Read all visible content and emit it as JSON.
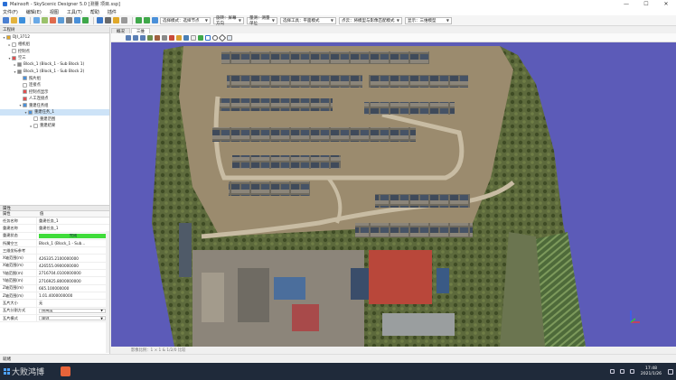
{
  "titlebar": {
    "title": "Mainsoft - SkyScenic Designer 5.0 [测量 项目.ssp]",
    "btns": [
      "—",
      "☐",
      "✕"
    ]
  },
  "menu": [
    "文件(F)",
    "编辑(E)",
    "视图",
    "工具(T)",
    "帮助",
    "插件"
  ],
  "toolbar": {
    "combos": [
      {
        "label": "选择模式：选择节点",
        "w": 56
      },
      {
        "label": "旋转：屏幕方向",
        "w": 34
      },
      {
        "label": "量测：测量单位",
        "w": 34
      },
      {
        "label": "选择工具：平面模式",
        "w": 62
      },
      {
        "label": "点云：将模型与影像匹配模式",
        "w": 70
      },
      {
        "label": "显示：三维模型",
        "w": 52
      }
    ]
  },
  "left_panel": {
    "title": "工程树",
    "tree": [
      {
        "indent": 0,
        "exp": "▾",
        "icon": "#e0a828",
        "label": "DJI_3712"
      },
      {
        "indent": 1,
        "exp": "▸",
        "icon": "#ffffff",
        "label": "相机组"
      },
      {
        "indent": 1,
        "exp": "",
        "icon": "#ffffff",
        "label": "控制点"
      },
      {
        "indent": 1,
        "exp": "▾",
        "icon": "#e05050",
        "label": "空三"
      },
      {
        "indent": 2,
        "exp": "▸",
        "icon": "#888888",
        "label": "Block_1 (Block_1 - Sub Block 1)"
      },
      {
        "indent": 2,
        "exp": "▾",
        "icon": "#888888",
        "label": "Block_1 (Block_1 - Sub Block 2)"
      },
      {
        "indent": 3,
        "exp": "",
        "icon": "#4a90d9",
        "label": "照片组"
      },
      {
        "indent": 3,
        "exp": "",
        "icon": "#ffffff",
        "label": "连接点"
      },
      {
        "indent": 3,
        "exp": "",
        "icon": "#e05050",
        "label": "控制点显示"
      },
      {
        "indent": 3,
        "exp": "",
        "icon": "#e05050",
        "label": "人工连接点"
      },
      {
        "indent": 3,
        "exp": "▾",
        "icon": "#4a90d9",
        "label": "重建任务组"
      },
      {
        "indent": 4,
        "exp": "▾",
        "icon": "#4a90d9",
        "label": "重建任务_1",
        "selected": true
      },
      {
        "indent": 5,
        "exp": "",
        "icon": "#ffffff",
        "label": "重建范围"
      },
      {
        "indent": 5,
        "exp": "▸",
        "icon": "#ffffff",
        "label": "重建结果"
      }
    ]
  },
  "props": {
    "title": "属性",
    "col_name": "属性",
    "col_value": "值",
    "rows": [
      {
        "k": "任务名称",
        "v": "重建任务_1",
        "type": "text"
      },
      {
        "k": "重建名称",
        "v": "重建任务_1",
        "type": "text"
      },
      {
        "k": "重建状态",
        "v": "完成",
        "type": "green"
      },
      {
        "k": "所属空三",
        "v": "Block_1 (Block_1 - Sub...",
        "type": "text"
      },
      {
        "k": "三维坐标参考",
        "v": "",
        "type": "text"
      },
      {
        "k": "X轴范围(m)",
        "v": "426335.2100000000",
        "type": "text"
      },
      {
        "k": "X轴范围(m)",
        "v": "426555.0900000000",
        "type": "text"
      },
      {
        "k": "Y轴范围(m)",
        "v": "2716704.0100000000",
        "type": "text"
      },
      {
        "k": "Y轴范围(m)",
        "v": "2716925.8000000000",
        "type": "text"
      },
      {
        "k": "Z轴范围(m)",
        "v": "665.100000000",
        "type": "text"
      },
      {
        "k": "Z轴范围(m)",
        "v": "1.01.4000000000",
        "type": "text"
      },
      {
        "k": "瓦片大小",
        "v": "无",
        "type": "text"
      },
      {
        "k": "瓦片分割方式",
        "v": "按高度",
        "type": "combo"
      },
      {
        "k": "瓦片模式",
        "v": "规则",
        "type": "combo"
      }
    ]
  },
  "view": {
    "tabs": [
      {
        "label": "概况",
        "active": false
      },
      {
        "label": "三维",
        "active": true
      }
    ]
  },
  "viewport_status": "影像比例：1 × 1 & 1/2/0 比较",
  "statusbar": "就绪",
  "taskbar": {
    "watermark": "大败鸿博",
    "time": "17:48",
    "date": "2021/1/26"
  },
  "colors": {
    "viewport_bg": "#5c5bb8",
    "green_status": "#3fdc3a",
    "selection": "#cde3f7"
  }
}
